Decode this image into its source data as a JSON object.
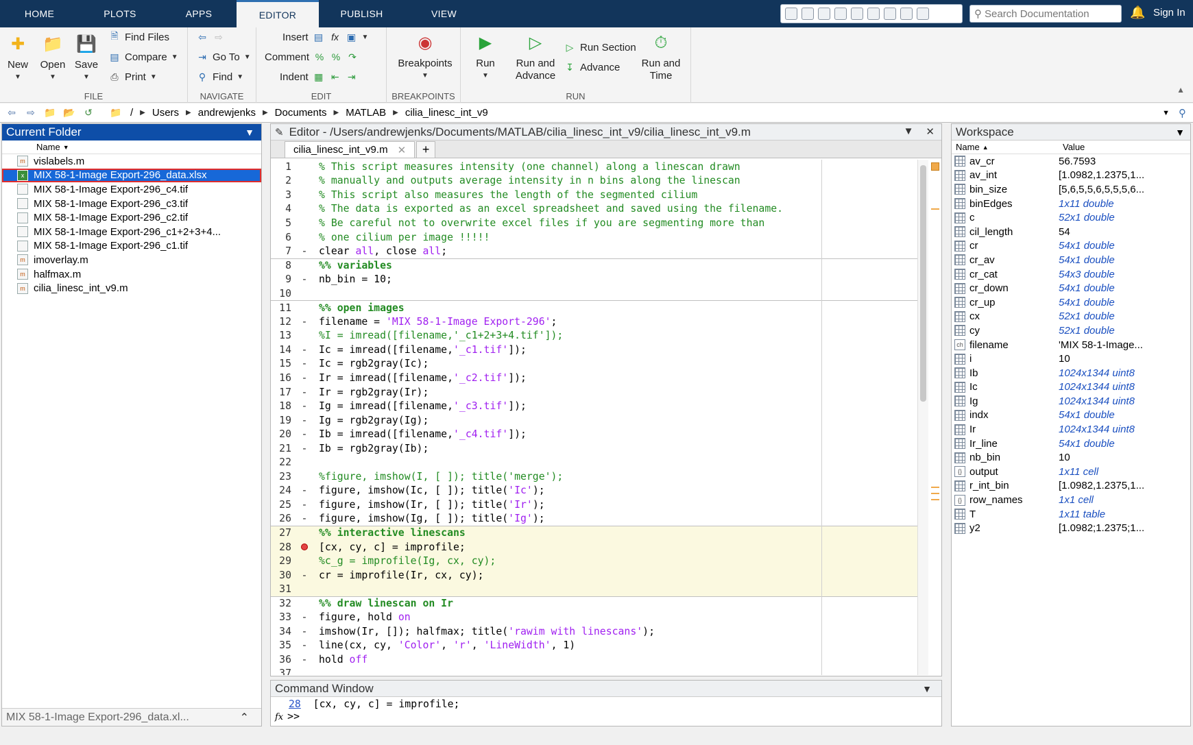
{
  "tabs": [
    "HOME",
    "PLOTS",
    "APPS",
    "EDITOR",
    "PUBLISH",
    "VIEW"
  ],
  "active_tab": "EDITOR",
  "search_placeholder": "Search Documentation",
  "sign_in": "Sign In",
  "toolstrip": {
    "file": {
      "label": "FILE",
      "new": "New",
      "open": "Open",
      "save": "Save",
      "find_files": "Find Files",
      "compare": "Compare",
      "print": "Print"
    },
    "navigate": {
      "label": "NAVIGATE",
      "goto": "Go To",
      "find": "Find"
    },
    "edit": {
      "label": "EDIT",
      "insert": "Insert",
      "comment": "Comment",
      "indent": "Indent"
    },
    "breakpoints": {
      "label": "BREAKPOINTS",
      "breakpoints": "Breakpoints"
    },
    "run": {
      "label": "RUN",
      "run": "Run",
      "run_and_advance_1": "Run and",
      "run_and_advance_2": "Advance",
      "run_section": "Run Section",
      "advance": "Advance",
      "run_and_time_1": "Run and",
      "run_and_time_2": "Time"
    }
  },
  "address": {
    "root": "/",
    "crumbs": [
      "Users",
      "andrewjenks",
      "Documents",
      "MATLAB",
      "cilia_linesc_int_v9"
    ]
  },
  "current_folder": {
    "title": "Current Folder",
    "column": "Name",
    "files": [
      {
        "name": "vislabels.m",
        "type": "m"
      },
      {
        "name": "MIX 58-1-Image Export-296_data.xlsx",
        "type": "xlsx",
        "selected": true
      },
      {
        "name": "MIX 58-1-Image Export-296_c4.tif",
        "type": "tif"
      },
      {
        "name": "MIX 58-1-Image Export-296_c3.tif",
        "type": "tif"
      },
      {
        "name": "MIX 58-1-Image Export-296_c2.tif",
        "type": "tif"
      },
      {
        "name": "MIX 58-1-Image Export-296_c1+2+3+4...",
        "type": "tif"
      },
      {
        "name": "MIX 58-1-Image Export-296_c1.tif",
        "type": "tif"
      },
      {
        "name": "imoverlay.m",
        "type": "m"
      },
      {
        "name": "halfmax.m",
        "type": "m"
      },
      {
        "name": "cilia_linesc_int_v9.m",
        "type": "m"
      }
    ],
    "details": "MIX 58-1-Image Export-296_data.xl..."
  },
  "editor": {
    "title": "Editor - /Users/andrewjenks/Documents/MATLAB/cilia_linesc_int_v9/cilia_linesc_int_v9.m",
    "tab": "cilia_linesc_int_v9.m",
    "lines": [
      {
        "n": "1",
        "m": "",
        "t": "% This script measures intensity (one channel) along a linescan drawn"
      },
      {
        "n": "2",
        "m": "",
        "t": "% manually and outputs average intensity in n bins along the linescan"
      },
      {
        "n": "3",
        "m": "",
        "t": "% This script also measures the length of the segmented cilium"
      },
      {
        "n": "4",
        "m": "",
        "t": "% The data is exported as an excel spreadsheet and saved using the filename."
      },
      {
        "n": "5",
        "m": "",
        "t": "% Be careful not to overwrite excel files if you are segmenting more than"
      },
      {
        "n": "6",
        "m": "",
        "t": "% one cilium per image !!!!!"
      },
      {
        "n": "7",
        "m": "-",
        "t": "clear all, close all;"
      },
      {
        "n": "8",
        "m": "",
        "t": "%% variables"
      },
      {
        "n": "9",
        "m": "-",
        "t": "nb_bin = 10;"
      },
      {
        "n": "10",
        "m": "",
        "t": ""
      },
      {
        "n": "11",
        "m": "",
        "t": "%% open images"
      },
      {
        "n": "12",
        "m": "-",
        "t": "filename = 'MIX 58-1-Image Export-296';"
      },
      {
        "n": "13",
        "m": "",
        "t": "%I = imread([filename,'_c1+2+3+4.tif']);"
      },
      {
        "n": "14",
        "m": "-",
        "t": "Ic = imread([filename,'_c1.tif']);"
      },
      {
        "n": "15",
        "m": "-",
        "t": "Ic = rgb2gray(Ic);"
      },
      {
        "n": "16",
        "m": "-",
        "t": "Ir = imread([filename,'_c2.tif']);"
      },
      {
        "n": "17",
        "m": "-",
        "t": "Ir = rgb2gray(Ir);"
      },
      {
        "n": "18",
        "m": "-",
        "t": "Ig = imread([filename,'_c3.tif']);"
      },
      {
        "n": "19",
        "m": "-",
        "t": "Ig = rgb2gray(Ig);"
      },
      {
        "n": "20",
        "m": "-",
        "t": "Ib = imread([filename,'_c4.tif']);"
      },
      {
        "n": "21",
        "m": "-",
        "t": "Ib = rgb2gray(Ib);"
      },
      {
        "n": "22",
        "m": "",
        "t": ""
      },
      {
        "n": "23",
        "m": "",
        "t": "%figure, imshow(I, [ ]); title('merge');"
      },
      {
        "n": "24",
        "m": "-",
        "t": "figure, imshow(Ic, [ ]); title('Ic');"
      },
      {
        "n": "25",
        "m": "-",
        "t": "figure, imshow(Ir, [ ]); title('Ir');"
      },
      {
        "n": "26",
        "m": "-",
        "t": "figure, imshow(Ig, [ ]); title('Ig');"
      },
      {
        "n": "27",
        "m": "",
        "t": "%% interactive linescans"
      },
      {
        "n": "28",
        "m": "bp",
        "t": "[cx, cy, c] = improfile;"
      },
      {
        "n": "29",
        "m": "",
        "t": "%c_g = improfile(Ig, cx, cy);"
      },
      {
        "n": "30",
        "m": "-",
        "t": "cr = improfile(Ir, cx, cy);"
      },
      {
        "n": "31",
        "m": "",
        "t": ""
      },
      {
        "n": "32",
        "m": "",
        "t": "%% draw linescan on Ir"
      },
      {
        "n": "33",
        "m": "-",
        "t": "figure, hold on"
      },
      {
        "n": "34",
        "m": "-",
        "t": "imshow(Ir, []); halfmax; title('rawim with linescans');"
      },
      {
        "n": "35",
        "m": "-",
        "t": "line(cx, cy, 'Color', 'r', 'LineWidth', 1)"
      },
      {
        "n": "36",
        "m": "-",
        "t": "hold off"
      },
      {
        "n": "37",
        "m": "",
        "t": ""
      }
    ]
  },
  "command_window": {
    "title": "Command Window",
    "line_no": "28",
    "line_text": "[cx, cy, c] = improfile;",
    "prompt": ">>",
    "fx": "fx"
  },
  "workspace": {
    "title": "Workspace",
    "col_name": "Name",
    "col_value": "Value",
    "vars": [
      {
        "name": "av_cr",
        "value": "56.7593",
        "link": false,
        "icon": "grid"
      },
      {
        "name": "av_int",
        "value": "[1.0982,1.2375,1...",
        "link": false,
        "icon": "grid"
      },
      {
        "name": "bin_size",
        "value": "[5,6,5,5,6,5,5,5,6...",
        "link": false,
        "icon": "grid"
      },
      {
        "name": "binEdges",
        "value": "1x11 double",
        "link": true,
        "icon": "grid"
      },
      {
        "name": "c",
        "value": "52x1 double",
        "link": true,
        "icon": "grid"
      },
      {
        "name": "cil_length",
        "value": "54",
        "link": false,
        "icon": "grid"
      },
      {
        "name": "cr",
        "value": "54x1 double",
        "link": true,
        "icon": "grid"
      },
      {
        "name": "cr_av",
        "value": "54x1 double",
        "link": true,
        "icon": "grid"
      },
      {
        "name": "cr_cat",
        "value": "54x3 double",
        "link": true,
        "icon": "grid"
      },
      {
        "name": "cr_down",
        "value": "54x1 double",
        "link": true,
        "icon": "grid"
      },
      {
        "name": "cr_up",
        "value": "54x1 double",
        "link": true,
        "icon": "grid"
      },
      {
        "name": "cx",
        "value": "52x1 double",
        "link": true,
        "icon": "grid"
      },
      {
        "name": "cy",
        "value": "52x1 double",
        "link": true,
        "icon": "grid"
      },
      {
        "name": "filename",
        "value": "'MIX 58-1-Image...",
        "link": false,
        "icon": "char"
      },
      {
        "name": "i",
        "value": "10",
        "link": false,
        "icon": "grid"
      },
      {
        "name": "Ib",
        "value": "1024x1344 uint8",
        "link": true,
        "icon": "grid"
      },
      {
        "name": "Ic",
        "value": "1024x1344 uint8",
        "link": true,
        "icon": "grid"
      },
      {
        "name": "Ig",
        "value": "1024x1344 uint8",
        "link": true,
        "icon": "grid"
      },
      {
        "name": "indx",
        "value": "54x1 double",
        "link": true,
        "icon": "grid"
      },
      {
        "name": "Ir",
        "value": "1024x1344 uint8",
        "link": true,
        "icon": "grid"
      },
      {
        "name": "Ir_line",
        "value": "54x1 double",
        "link": true,
        "icon": "grid"
      },
      {
        "name": "nb_bin",
        "value": "10",
        "link": false,
        "icon": "grid"
      },
      {
        "name": "output",
        "value": "1x11 cell",
        "link": true,
        "icon": "cell"
      },
      {
        "name": "r_int_bin",
        "value": "[1.0982,1.2375,1...",
        "link": false,
        "icon": "grid"
      },
      {
        "name": "row_names",
        "value": "1x1 cell",
        "link": true,
        "icon": "cell"
      },
      {
        "name": "T",
        "value": "1x11 table",
        "link": true,
        "icon": "grid"
      },
      {
        "name": "y2",
        "value": "[1.0982;1.2375;1...",
        "link": false,
        "icon": "grid"
      }
    ]
  }
}
